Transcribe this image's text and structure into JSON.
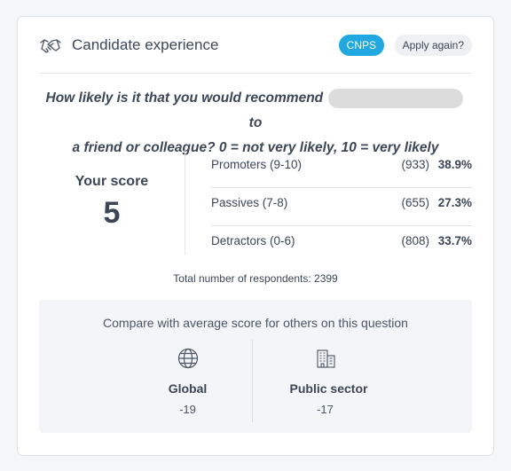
{
  "header": {
    "title": "Candidate experience",
    "badge": "CNPS",
    "apply_again": "Apply again?"
  },
  "question": {
    "line1_start": "How likely is it that you would recommend",
    "line1_end": "to",
    "line2": "a friend or colleague? 0 = not very likely, 10 = very likely"
  },
  "score": {
    "label": "Your score",
    "value": "5"
  },
  "breakdown": [
    {
      "label": "Promoters (9-10)",
      "count": "(933)",
      "percent": "38.9%"
    },
    {
      "label": "Passives (7-8)",
      "count": "(655)",
      "percent": "27.3%"
    },
    {
      "label": "Detractors (0-6)",
      "count": "(808)",
      "percent": "33.7%"
    }
  ],
  "total": "Total number of respondents: 2399",
  "compare": {
    "title": "Compare with average score for others on this question",
    "items": [
      {
        "name": "Global",
        "value": "-19",
        "icon": "globe-icon"
      },
      {
        "name": "Public sector",
        "value": "-17",
        "icon": "building-icon"
      }
    ]
  },
  "colors": {
    "accent": "#22a8e0",
    "text": "#3b4656",
    "panel": "#f3f5f8"
  }
}
